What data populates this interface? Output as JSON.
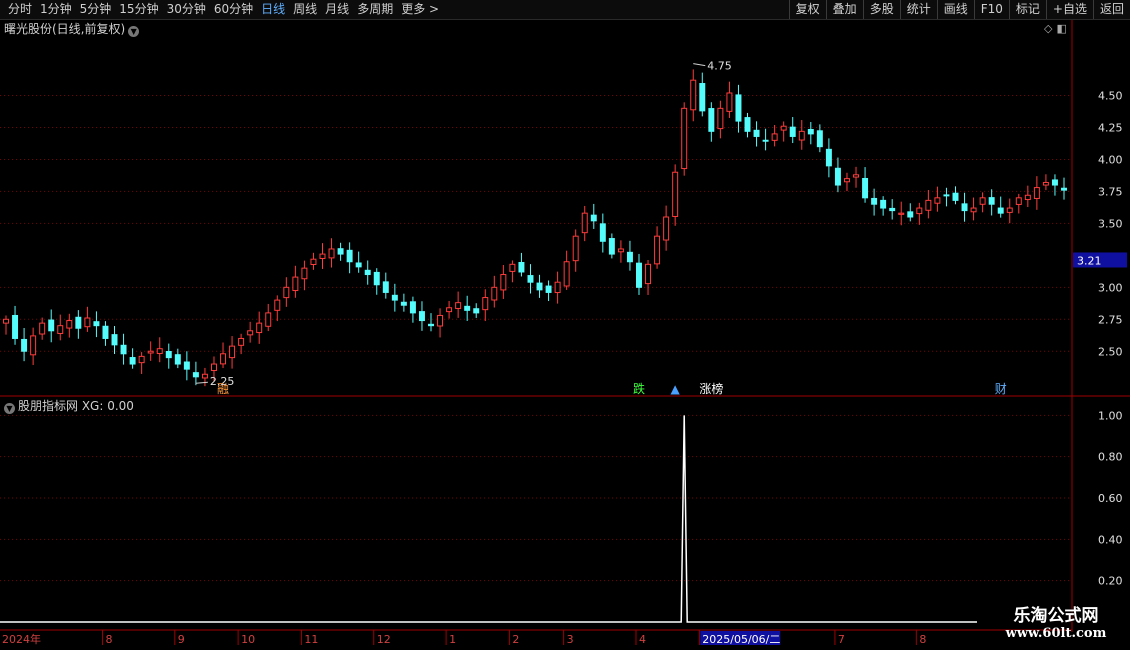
{
  "toolbar": {
    "periods": [
      {
        "label": "分时",
        "active": false
      },
      {
        "label": "1分钟",
        "active": false
      },
      {
        "label": "5分钟",
        "active": false
      },
      {
        "label": "15分钟",
        "active": false
      },
      {
        "label": "30分钟",
        "active": false
      },
      {
        "label": "60分钟",
        "active": false
      },
      {
        "label": "日线",
        "active": true
      },
      {
        "label": "周线",
        "active": false
      },
      {
        "label": "月线",
        "active": false
      },
      {
        "label": "多周期",
        "active": false
      },
      {
        "label": "更多 >",
        "active": false
      }
    ],
    "actions": [
      "复权",
      "叠加",
      "多股",
      "统计",
      "画线",
      "F10",
      "标记",
      "+自选",
      "返回"
    ]
  },
  "main_title": "曙光股份(日线,前复权)",
  "sub_title": "股朋指标网  XG: 0.00",
  "colors": {
    "up": "#ff3c3c",
    "down": "#54fcfc",
    "grid": "#7a0000",
    "axis": "#a00000",
    "price_tag_bg": "#1010a0",
    "signal": "#ffffff"
  },
  "main_axis": {
    "ylim": [
      2.15,
      4.95
    ],
    "ticks": [
      "4.50",
      "4.25",
      "4.00",
      "3.75",
      "3.50",
      "3.00",
      "2.75",
      "2.50"
    ],
    "tick_values": [
      4.5,
      4.25,
      4.0,
      3.75,
      3.5,
      3.0,
      2.75,
      2.5
    ],
    "current_price": "3.21",
    "current_value": 3.21
  },
  "annotations": {
    "high": "4.75",
    "high_value": 4.75,
    "low": "2.25",
    "low_value": 2.25
  },
  "event_labels": [
    {
      "text": "融",
      "color": "#ff9a40",
      "index": 24
    },
    {
      "text": "跌",
      "color": "#40ff40",
      "index": 70
    },
    {
      "text": "▲",
      "color": "#4aa0ff",
      "index": 74
    },
    {
      "text": "涨榜",
      "color": "#ffffff",
      "index": 78
    },
    {
      "text": "财",
      "color": "#60b0ff",
      "index": 110
    }
  ],
  "sub_axis": {
    "ylim": [
      0.0,
      1.05
    ],
    "ticks": [
      "1.00",
      "0.80",
      "0.60",
      "0.40",
      "0.20"
    ],
    "tick_values": [
      1.0,
      0.8,
      0.6,
      0.4,
      0.2
    ]
  },
  "date_axis": [
    {
      "label": "2024年",
      "index": 0
    },
    {
      "label": "8",
      "index": 11
    },
    {
      "label": "9",
      "index": 19
    },
    {
      "label": "10",
      "index": 26
    },
    {
      "label": "11",
      "index": 33
    },
    {
      "label": "12",
      "index": 41
    },
    {
      "label": "1",
      "index": 49
    },
    {
      "label": "2",
      "index": 56
    },
    {
      "label": "3",
      "index": 62
    },
    {
      "label": "4",
      "index": 70
    },
    {
      "label": "2025/05/06/二",
      "index": 77,
      "highlight": true
    },
    {
      "label": "7",
      "index": 92
    },
    {
      "label": "8",
      "index": 101
    }
  ],
  "watermark": {
    "title": "乐淘公式网",
    "url": "www.60lt.com"
  },
  "chart_data": {
    "type": "candlestick",
    "title": "曙光股份(日线,前复权)",
    "ylim": [
      2.15,
      4.95
    ],
    "signal_index": 75,
    "closes": [
      2.75,
      2.6,
      2.5,
      2.62,
      2.72,
      2.66,
      2.7,
      2.74,
      2.68,
      2.76,
      2.7,
      2.6,
      2.55,
      2.48,
      2.4,
      2.46,
      2.5,
      2.52,
      2.45,
      2.4,
      2.36,
      2.3,
      2.32,
      2.4,
      2.48,
      2.54,
      2.6,
      2.66,
      2.72,
      2.8,
      2.9,
      3.0,
      3.08,
      3.15,
      3.22,
      3.26,
      3.3,
      3.26,
      3.2,
      3.16,
      3.1,
      3.02,
      2.96,
      2.9,
      2.86,
      2.8,
      2.74,
      2.7,
      2.78,
      2.84,
      2.88,
      2.82,
      2.8,
      2.92,
      3.0,
      3.1,
      3.18,
      3.12,
      3.04,
      2.98,
      2.96,
      3.04,
      3.2,
      3.4,
      3.58,
      3.52,
      3.36,
      3.26,
      3.3,
      3.2,
      3.0,
      3.18,
      3.4,
      3.55,
      3.9,
      4.4,
      4.62,
      4.38,
      4.22,
      4.4,
      4.52,
      4.3,
      4.22,
      4.18,
      4.15,
      4.2,
      4.26,
      4.18,
      4.22,
      4.2,
      4.1,
      3.95,
      3.8,
      3.85,
      3.88,
      3.7,
      3.65,
      3.62,
      3.6,
      3.58,
      3.55,
      3.62,
      3.68,
      3.7,
      3.72,
      3.68,
      3.6,
      3.62,
      3.7,
      3.65,
      3.58,
      3.62,
      3.7,
      3.72,
      3.78,
      3.82,
      3.8,
      3.76
    ]
  }
}
